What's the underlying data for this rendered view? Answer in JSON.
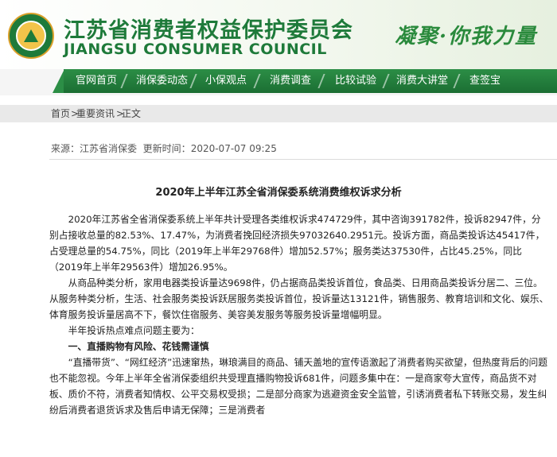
{
  "header": {
    "title_cn": "江苏省消费者权益保护委员会",
    "title_en": "JIANGSU CONSUMER COUNCIL",
    "slogan": "凝聚·你我力量",
    "logo_icon": "consumer-council-seal",
    "brand_green": "#1e7a3a"
  },
  "nav": {
    "items": [
      {
        "label": "官网首页"
      },
      {
        "label": "消保委动态"
      },
      {
        "label": "小保观点"
      },
      {
        "label": "消费调查"
      },
      {
        "label": "比较试验"
      },
      {
        "label": "消费大讲堂"
      },
      {
        "label": "查签宝"
      }
    ]
  },
  "breadcrumb": {
    "home": "首页",
    "sep1": ">",
    "section": "重要资讯",
    "sep2": ">",
    "current": "正文"
  },
  "meta": {
    "source_label": "来源：",
    "source": "江苏省消保委",
    "time_label": "更新时间：",
    "time": "2020-07-07 09:25"
  },
  "article": {
    "title": "2020年上半年江苏全省消保委系统消费维权诉求分析",
    "paragraphs": [
      "2020年江苏省全省消保委系统上半年共计受理各类维权诉求474729件，其中咨询391782件，投诉82947件，分别占接收总量的82.53%、17.47%，为消费者挽回经济损失97032640.2951元。投诉方面，商品类投诉达45417件，占受理总量的54.75%，同比（2019年上半年29768件）增加52.57%；服务类达37530件，占比45.25%，同比（2019年上半年29563件）增加26.95%。",
      "从商品种类分析，家用电器类投诉量达9698件，仍占据商品类投诉首位，食品类、日用商品类投诉分居二、三位。从服务种类分析，生活、社会服务类投诉跃居服务类投诉首位，投诉量达13121件，销售服务、教育培训和文化、娱乐、体育服务投诉量居高不下，餐饮住宿服务、美容美发服务等服务投诉量增幅明显。",
      "半年投诉热点难点问题主要为：",
      "一、直播购物有风险、花钱需谨慎",
      "“直播带货”、“网红经济”迅速窜热，琳琅满目的商品、铺天盖地的宣传语激起了消费者购买欲望，但热度背后的问题也不能忽视。今年上半年全省消保委组织共受理直播购物投诉681件，问题多集中在：一是商家夸大宣传，商品货不对板、质价不符，消费者知情权、公平交易权受损；二是部分商家为逃避资金安全监管，引诱消费者私下转账交易，发生纠纷后消费者退货诉求及售后申请无保障；三是消费者"
    ]
  }
}
